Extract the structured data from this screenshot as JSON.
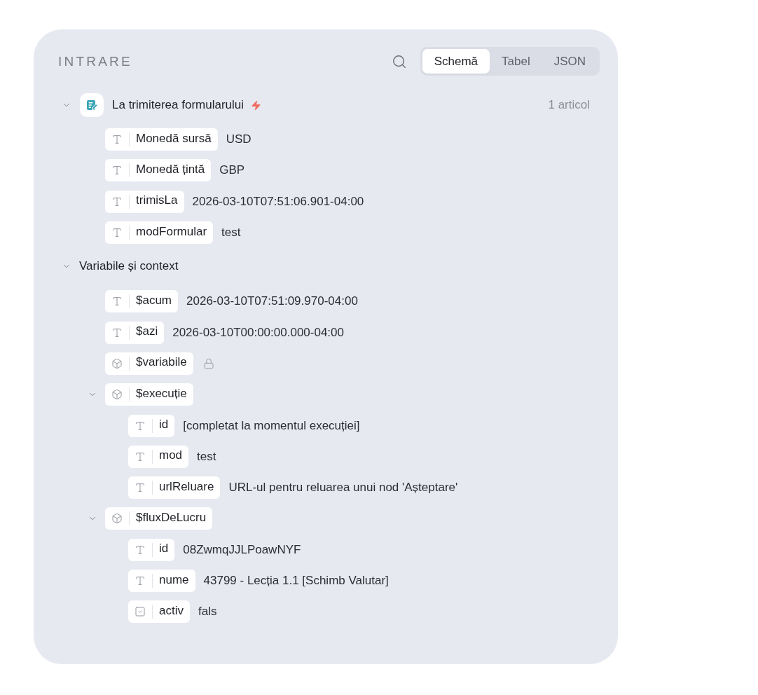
{
  "header": {
    "title": "INTRARE",
    "view_tabs": [
      {
        "label": "Schemă",
        "selected": true
      },
      {
        "label": "Tabel",
        "selected": false
      },
      {
        "label": "JSON",
        "selected": false
      }
    ]
  },
  "tree": [
    {
      "kind": "node",
      "label": "La trimiterea formularului",
      "trigger": true,
      "count": "1 articol",
      "expanded": true,
      "children": [
        {
          "kind": "text",
          "name": "Monedă sursă",
          "value": "USD"
        },
        {
          "kind": "text",
          "name": "Monedă țintă",
          "value": "GBP"
        },
        {
          "kind": "text",
          "name": "trimisLa",
          "value": "2026-03-10T07:51:06.901-04:00"
        },
        {
          "kind": "text",
          "name": "modFormular",
          "value": "test"
        }
      ]
    },
    {
      "kind": "group",
      "label": "Variabile și context",
      "expanded": true,
      "children": [
        {
          "kind": "text",
          "name": "$acum",
          "value": "2026-03-10T07:51:09.970-04:00",
          "locked": false
        },
        {
          "kind": "text",
          "name": "$azi",
          "value": "2026-03-10T00:00:00.000-04:00",
          "locked": false
        },
        {
          "kind": "object",
          "name": "$variabile",
          "locked": true
        },
        {
          "kind": "object",
          "name": "$execuție",
          "locked": false,
          "expanded": true,
          "children": [
            {
              "kind": "text",
              "name": "id",
              "value": "[completat la momentul execuției]"
            },
            {
              "kind": "text",
              "name": "mod",
              "value": "test"
            },
            {
              "kind": "text",
              "name": "urlReluare",
              "value": "URL-ul pentru reluarea unui nod 'Așteptare'"
            }
          ]
        },
        {
          "kind": "object",
          "name": "$fluxDeLucru",
          "locked": false,
          "expanded": true,
          "children": [
            {
              "kind": "text",
              "name": "id",
              "value": "08ZwmqJJLPoawNYF"
            },
            {
              "kind": "text",
              "name": "nume",
              "value": "43799 - Lecția 1.1 [Schimb Valutar]"
            },
            {
              "kind": "boolean",
              "name": "activ",
              "value": "fals"
            }
          ]
        }
      ]
    }
  ]
}
